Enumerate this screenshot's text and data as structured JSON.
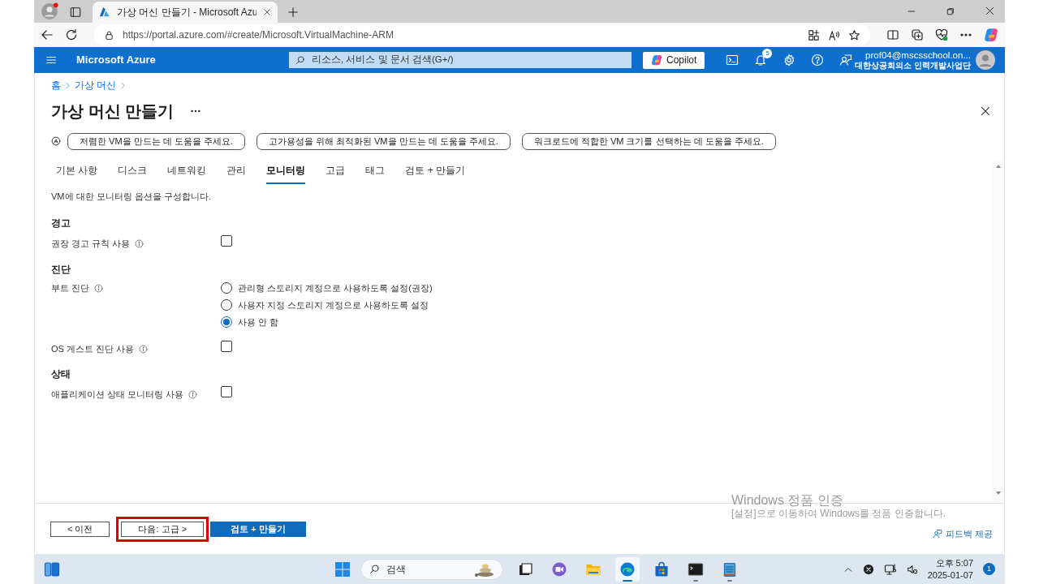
{
  "browser": {
    "tab_title": "가상 머신 만들기 - Microsoft Azu",
    "url": "https://portal.azure.com/#create/Microsoft.VirtualMachine-ARM"
  },
  "portal_header": {
    "brand": "Microsoft Azure",
    "search_placeholder": "리소스, 서비스 및 문서 검색(G+/)",
    "copilot": "Copilot",
    "notification_count": "5",
    "account": "prof04@mscsschool.on...",
    "directory": "대한상공회의소 인력개발사업단"
  },
  "breadcrumb": [
    "홈",
    "가상 머신"
  ],
  "page_title": "가상 머신 만들기",
  "prompts": [
    "저렴한 VM을 만드는 데 도움을 주세요.",
    "고가용성을 위해 최적화된 VM을 만드는 데 도움을 주세요.",
    "워크로드에 적합한 VM 크기를 선택하는 데 도움을 주세요."
  ],
  "tabs": [
    {
      "label": "기본 사항",
      "selected": false
    },
    {
      "label": "디스크",
      "selected": false
    },
    {
      "label": "네트워킹",
      "selected": false
    },
    {
      "label": "관리",
      "selected": false
    },
    {
      "label": "모니터링",
      "selected": true
    },
    {
      "label": "고급",
      "selected": false
    },
    {
      "label": "태그",
      "selected": false
    },
    {
      "label": "검토 + 만들기",
      "selected": false
    }
  ],
  "description": "VM에 대한 모니터링 옵션을 구성합니다.",
  "sections": [
    {
      "title": "경고",
      "fields": [
        {
          "label": "권장 경고 규칙 사용",
          "kind": "checkbox",
          "checked": false
        }
      ]
    },
    {
      "title": "진단",
      "fields": [
        {
          "label": "부트 진단",
          "kind": "radio",
          "options": [
            {
              "label": "관리형 스토리지 계정으로 사용하도록 설정(권장)",
              "selected": false
            },
            {
              "label": "사용자 지정 스토리지 계정으로 사용하도록 설정",
              "selected": false
            },
            {
              "label": "사용 안 함",
              "selected": true
            }
          ]
        },
        {
          "label": "OS 게스트 진단 사용",
          "kind": "checkbox",
          "checked": false
        }
      ]
    },
    {
      "title": "상태",
      "fields": [
        {
          "label": "애플리케이션 상태 모니터링 사용",
          "kind": "checkbox",
          "checked": false
        }
      ]
    }
  ],
  "footer": {
    "buttons": [
      {
        "label": "< 이전",
        "kind": "secondary",
        "highlighted": false
      },
      {
        "label": "다음: 고급 >",
        "kind": "secondary",
        "highlighted": true
      },
      {
        "label": "검토 + 만들기",
        "kind": "primary",
        "highlighted": false
      }
    ],
    "feedback": "피드백 제공"
  },
  "activation_notice": {
    "title": "Windows 정품 인증",
    "message": "[설정]으로 이동하여 Windows를 정품 인증합니다."
  },
  "taskbar": {
    "search_placeholder": "검색",
    "apps": [
      {
        "kind": "taskview",
        "active": false,
        "running": false
      },
      {
        "kind": "chat",
        "active": false,
        "running": false
      },
      {
        "kind": "explorer",
        "active": false,
        "running": false
      },
      {
        "kind": "edge",
        "active": true,
        "running": true
      },
      {
        "kind": "store",
        "active": false,
        "running": false
      },
      {
        "kind": "terminal",
        "active": false,
        "running": true
      },
      {
        "kind": "notepad",
        "active": false,
        "running": true
      }
    ],
    "time": "오후 5:07",
    "date": "2025-01-07",
    "notification_count": "1"
  }
}
